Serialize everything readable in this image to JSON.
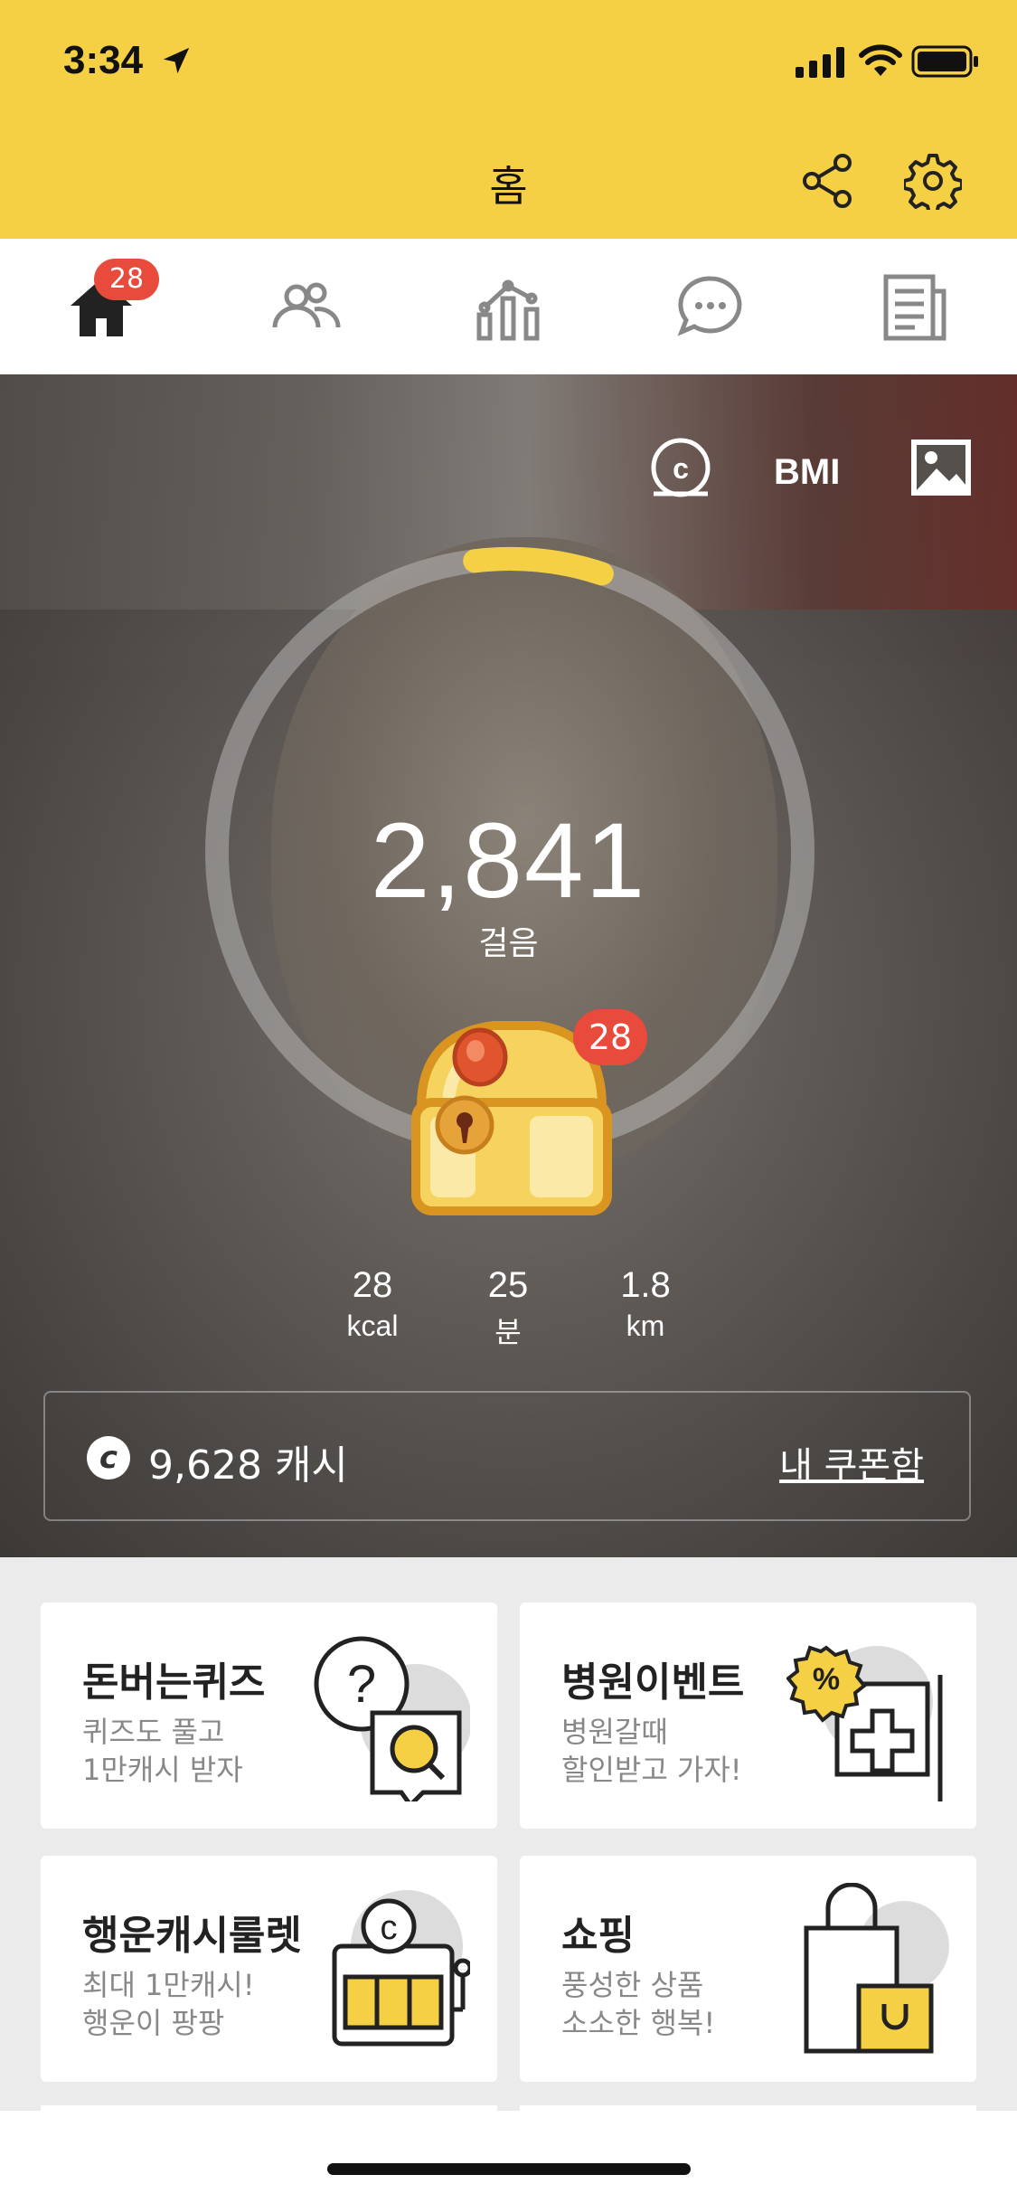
{
  "status": {
    "time": "3:34"
  },
  "header": {
    "title": "홈"
  },
  "tabs": {
    "home_badge": "28"
  },
  "hero": {
    "bmi_label": "BMI",
    "steps": "2,841",
    "steps_label": "걸음",
    "chest_badge": "28",
    "stats": [
      {
        "value": "28",
        "unit": "kcal"
      },
      {
        "value": "25",
        "unit": "분"
      },
      {
        "value": "1.8",
        "unit": "km"
      }
    ],
    "progress_fraction": 0.07
  },
  "cash": {
    "coin_glyph": "c",
    "amount": "9,628 캐시",
    "coupon_link": "내 쿠폰함"
  },
  "cards": [
    {
      "title": "돈버는퀴즈",
      "sub1": "퀴즈도 풀고",
      "sub2": "1만캐시 받자"
    },
    {
      "title": "병원이벤트",
      "sub1": "병원갈때",
      "sub2": "할인받고 가자!"
    },
    {
      "title": "행운캐시룰렛",
      "sub1": "최대 1만캐시!",
      "sub2": "행운이 팡팡"
    },
    {
      "title": "쇼핑",
      "sub1": "풍성한 상품",
      "sub2": "소소한 행복!"
    }
  ],
  "colors": {
    "brand_yellow": "#f5d044",
    "badge_red": "#e84a3c"
  }
}
